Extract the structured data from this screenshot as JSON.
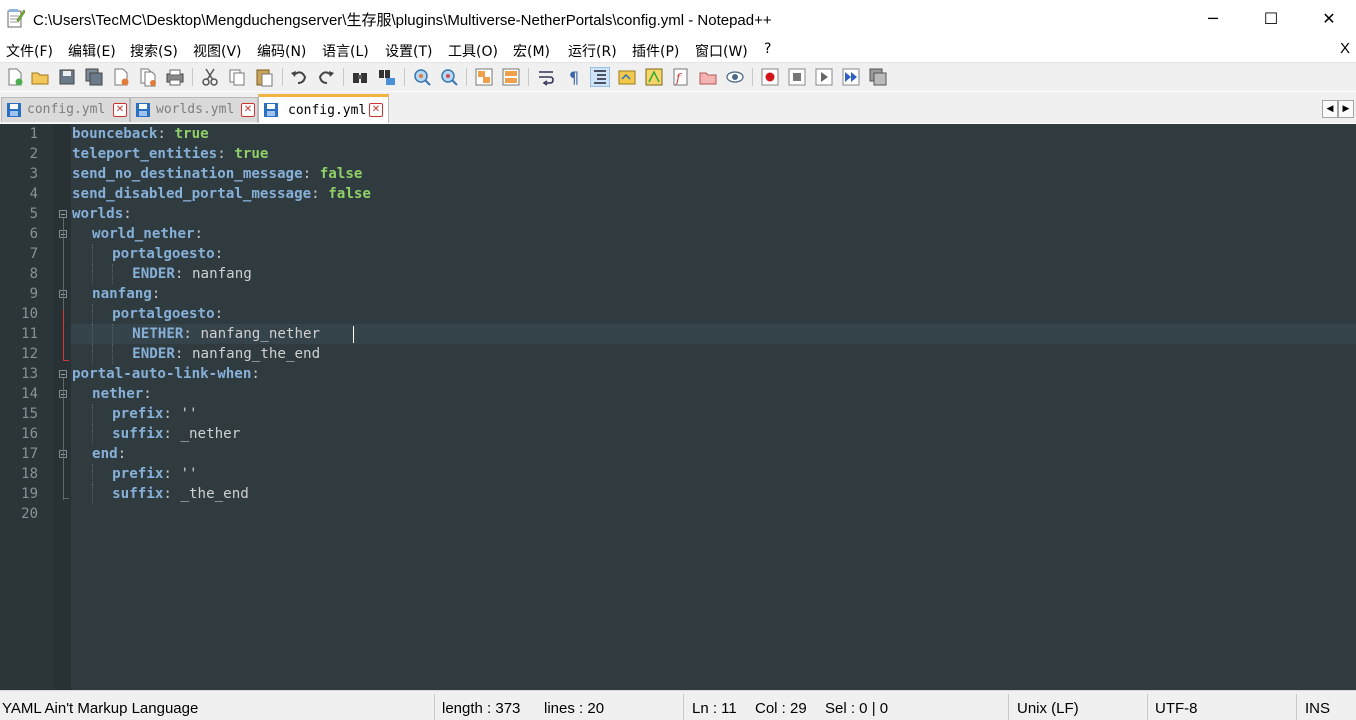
{
  "window": {
    "title": "C:\\Users\\TecMC\\Desktop\\Mengduchengserver\\生存服\\plugins\\Multiverse-NetherPortals\\config.yml - Notepad++",
    "minimize": "─",
    "maximize": "☐",
    "close": "✕"
  },
  "menu": {
    "items": [
      "文件(F)",
      "编辑(E)",
      "搜索(S)",
      "视图(V)",
      "编码(N)",
      "语言(L)",
      "设置(T)",
      "工具(O)",
      "宏(M)",
      "运行(R)",
      "插件(P)",
      "窗口(W)",
      "?"
    ],
    "close_doc": "X"
  },
  "toolbar": {
    "icons": [
      "new-file",
      "open-file",
      "save",
      "save-all",
      "close",
      "close-all",
      "print",
      "cut",
      "copy",
      "paste",
      "undo",
      "redo",
      "find",
      "replace",
      "zoom-in",
      "zoom-out",
      "sync-vertical",
      "sync-horizontal",
      "word-wrap",
      "show-all-chars",
      "indent-guide",
      "user-defined-lang",
      "doc-map",
      "function-list",
      "folder-as-workspace",
      "monitoring",
      "record-macro",
      "stop-record",
      "play-macro",
      "run-macro-multiple",
      "save-macro"
    ]
  },
  "tabs": [
    {
      "label": "config.yml",
      "active": false
    },
    {
      "label": "worlds.yml",
      "active": false
    },
    {
      "label": "config.yml",
      "active": true
    }
  ],
  "tab_scroll": {
    "left": "◀",
    "right": "▶"
  },
  "editor": {
    "lines": [
      {
        "n": "1",
        "indent": 0,
        "key": "bounceback",
        "sep": ": ",
        "value": "true",
        "vtype": "bool"
      },
      {
        "n": "2",
        "indent": 0,
        "key": "teleport_entities",
        "sep": ": ",
        "value": "true",
        "vtype": "bool"
      },
      {
        "n": "3",
        "indent": 0,
        "key": "send_no_destination_message",
        "sep": ": ",
        "value": "false",
        "vtype": "bool"
      },
      {
        "n": "4",
        "indent": 0,
        "key": "send_disabled_portal_message",
        "sep": ": ",
        "value": "false",
        "vtype": "bool"
      },
      {
        "n": "5",
        "indent": 0,
        "key": "worlds",
        "sep": ":",
        "value": "",
        "vtype": "none"
      },
      {
        "n": "6",
        "indent": 1,
        "key": "world_nether",
        "sep": ":",
        "value": "",
        "vtype": "none"
      },
      {
        "n": "7",
        "indent": 2,
        "key": "portalgoesto",
        "sep": ":",
        "value": "",
        "vtype": "none"
      },
      {
        "n": "8",
        "indent": 3,
        "key": "ENDER",
        "sep": ": ",
        "value": "nanfang",
        "vtype": "str"
      },
      {
        "n": "9",
        "indent": 1,
        "key": "nanfang",
        "sep": ":",
        "value": "",
        "vtype": "none"
      },
      {
        "n": "10",
        "indent": 2,
        "key": "portalgoesto",
        "sep": ":",
        "value": "",
        "vtype": "none"
      },
      {
        "n": "11",
        "indent": 3,
        "key": "NETHER",
        "sep": ": ",
        "value": "nanfang_nether",
        "vtype": "str"
      },
      {
        "n": "12",
        "indent": 3,
        "key": "ENDER",
        "sep": ": ",
        "value": "nanfang_the_end",
        "vtype": "str"
      },
      {
        "n": "13",
        "indent": 0,
        "key": "portal-auto-link-when",
        "sep": ":",
        "value": "",
        "vtype": "none"
      },
      {
        "n": "14",
        "indent": 1,
        "key": "nether",
        "sep": ":",
        "value": "",
        "vtype": "none"
      },
      {
        "n": "15",
        "indent": 2,
        "key": "prefix",
        "sep": ": ",
        "value": "''",
        "vtype": "str"
      },
      {
        "n": "16",
        "indent": 2,
        "key": "suffix",
        "sep": ": ",
        "value": "_nether",
        "vtype": "str"
      },
      {
        "n": "17",
        "indent": 1,
        "key": "end",
        "sep": ":",
        "value": "",
        "vtype": "none"
      },
      {
        "n": "18",
        "indent": 2,
        "key": "prefix",
        "sep": ": ",
        "value": "''",
        "vtype": "str"
      },
      {
        "n": "19",
        "indent": 2,
        "key": "suffix",
        "sep": ": ",
        "value": "_the_end",
        "vtype": "str"
      },
      {
        "n": "20",
        "indent": 0,
        "key": "",
        "sep": "",
        "value": "",
        "vtype": "none"
      }
    ],
    "current_line": 11
  },
  "status": {
    "language": "YAML Ain't Markup Language",
    "length": "length : 373",
    "lines": "lines : 20",
    "ln": "Ln : 11",
    "col": "Col : 29",
    "sel": "Sel : 0 | 0",
    "eol": "Unix (LF)",
    "encoding": "UTF-8",
    "mode": "INS"
  },
  "colors": {
    "editor_bg": "#2f3b3f",
    "key": "#87b0d8",
    "bool": "#8fcf66",
    "value": "#d0d0d0",
    "active_tab_accent": "#f2b440"
  }
}
